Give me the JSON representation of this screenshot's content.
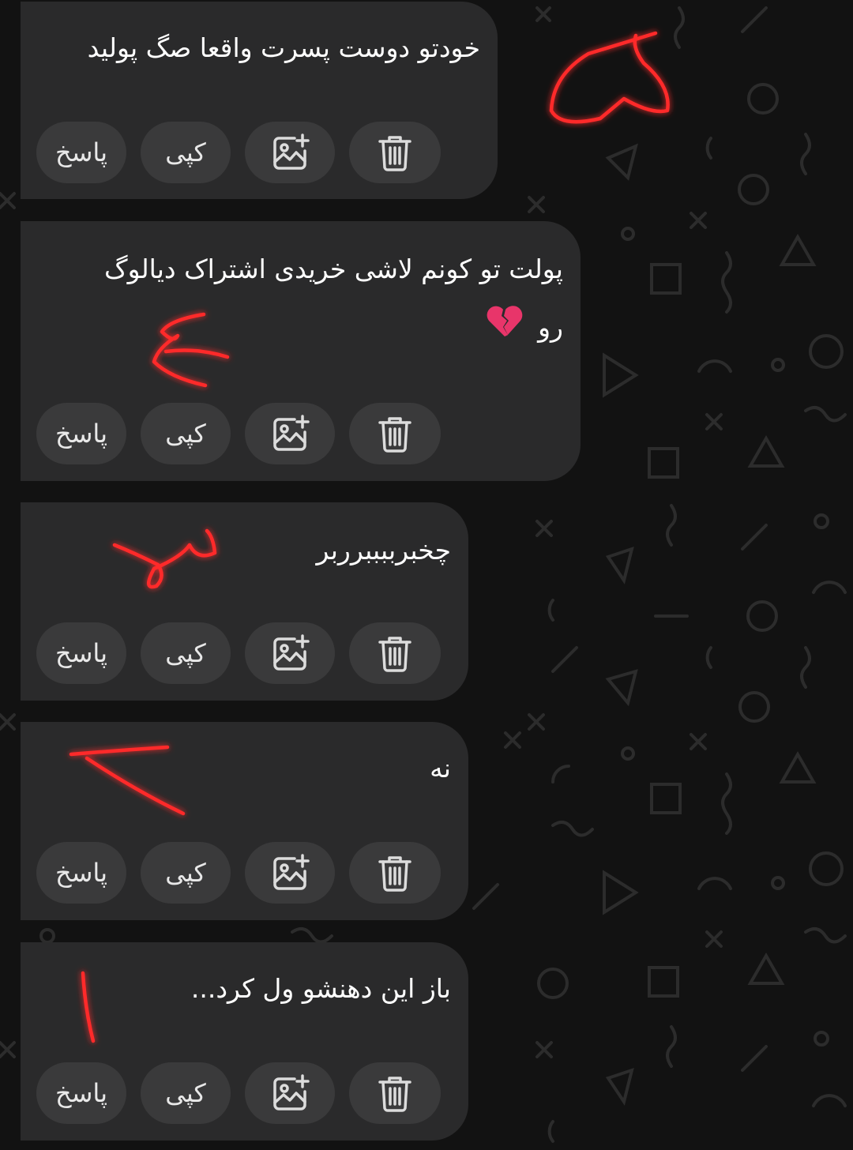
{
  "messages": [
    {
      "text": "خودتو دوست پسرت واقعا صگ پولید",
      "actions": {
        "reply": "پاسخ",
        "copy": "کپی"
      }
    },
    {
      "text": "پولت تو کونم لاشی خریدی اشتراک دیالوگ",
      "text_line2": "رو",
      "emoji": "broken-heart-icon",
      "actions": {
        "reply": "پاسخ",
        "copy": "کپی"
      }
    },
    {
      "text": "چخبرببببرربر",
      "actions": {
        "reply": "پاسخ",
        "copy": "کپی"
      }
    },
    {
      "text": "نه",
      "actions": {
        "reply": "پاسخ",
        "copy": "کپی"
      }
    },
    {
      "text": "باز این دهنشو ول کرد...",
      "actions": {
        "reply": "پاسخ",
        "copy": "کپی"
      }
    }
  ],
  "icons": [
    "add-image-icon",
    "trash-icon",
    "broken-heart-icon"
  ],
  "colors": {
    "background": "#121212",
    "bubble": "#2a2a2b",
    "button": "#3a3a3b",
    "annotation": "#ff2a2a"
  }
}
